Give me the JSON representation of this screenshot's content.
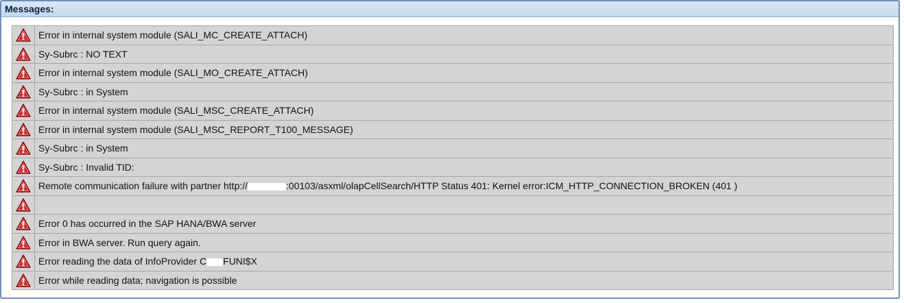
{
  "panel": {
    "title": "Messages:"
  },
  "messages": [
    {
      "icon": "error-triangle-icon",
      "text": "Error in internal system module (SALI_MC_CREATE_ATTACH)"
    },
    {
      "icon": "error-triangle-icon",
      "text": "Sy-Subrc : NO TEXT"
    },
    {
      "icon": "error-triangle-icon",
      "text": "Error in internal system module (SALI_MO_CREATE_ATTACH)"
    },
    {
      "icon": "error-triangle-icon",
      "text": "Sy-Subrc : in System"
    },
    {
      "icon": "error-triangle-icon",
      "text": "Error in internal system module (SALI_MSC_CREATE_ATTACH)"
    },
    {
      "icon": "error-triangle-icon",
      "text": "Error in internal system module (SALI_MSC_REPORT_T100_MESSAGE)"
    },
    {
      "icon": "error-triangle-icon",
      "text": "Sy-Subrc : in System"
    },
    {
      "icon": "error-triangle-icon",
      "text": "Sy-Subrc : Invalid TID:"
    },
    {
      "icon": "error-triangle-icon",
      "text_before": "Remote communication failure with partner http://",
      "text_after": ":00103/asxml/olapCellSearch/HTTP Status 401: Kernel error:ICM_HTTP_CONNECTION_BROKEN (401 )"
    },
    {
      "icon": "error-triangle-icon",
      "text": ""
    },
    {
      "icon": "error-triangle-icon",
      "text": "Error 0 has occurred in the SAP HANA/BWA server"
    },
    {
      "icon": "error-triangle-icon",
      "text": "Error in BWA server. Run query again."
    },
    {
      "icon": "error-triangle-icon",
      "text_before": "Error reading the data of InfoProvider C",
      "text_after": "FUNI$X"
    },
    {
      "icon": "error-triangle-icon",
      "text": "Error while reading data; navigation is possible"
    }
  ],
  "colors": {
    "error_icon_fill": "#d81e1e",
    "error_icon_stroke": "#7a0000",
    "row_background": "#d4d4d4",
    "header_background": "#c4d8ee"
  }
}
